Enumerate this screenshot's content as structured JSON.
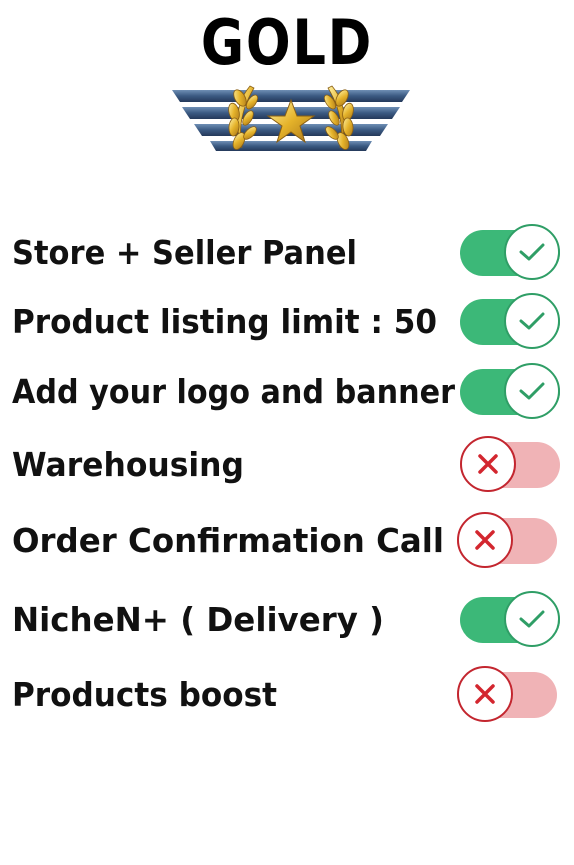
{
  "title": "GOLD",
  "badge": {
    "icon": "gold-rank-badge-icon",
    "stripe_color": "#3b5a82",
    "star_color": "#e5b32a"
  },
  "features": [
    {
      "label": "Store + Seller Panel",
      "enabled": true
    },
    {
      "label": "Product listing limit : 50",
      "enabled": true
    },
    {
      "label": "Add your logo and banner",
      "enabled": true
    },
    {
      "label": "Warehousing",
      "enabled": false
    },
    {
      "label": "Order Confirmation Call",
      "enabled": false
    },
    {
      "label": "NicheN+ ( Delivery )",
      "enabled": true
    },
    {
      "label": "Products boost",
      "enabled": false
    }
  ],
  "colors": {
    "on": "#3cb878",
    "off": "#f0b3b6",
    "check": "#2f9e66",
    "cross": "#d3262f"
  }
}
